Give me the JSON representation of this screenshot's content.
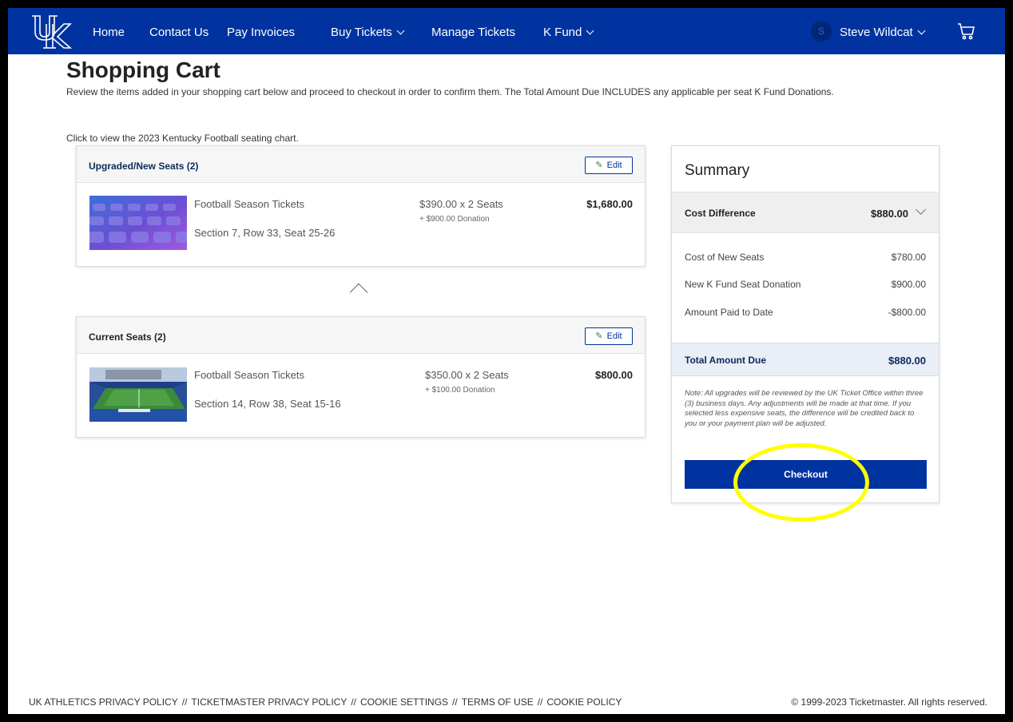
{
  "nav": {
    "logo_alt": "UK",
    "items": [
      {
        "label": "Home"
      },
      {
        "label": "Contact Us"
      },
      {
        "label": "Pay Invoices"
      },
      {
        "label": "Buy Tickets"
      },
      {
        "label": "Manage Tickets"
      },
      {
        "label": "K Fund"
      }
    ],
    "avatar_initial": "S",
    "user_name": "Steve Wildcat",
    "brand_color": "#0033a0"
  },
  "page": {
    "title": "Shopping Cart",
    "intro": "Review the items added in your shopping cart below and proceed to checkout in order to confirm them. The Total Amount Due INCLUDES any applicable per seat K Fund Donations.",
    "chart_link": "Click to view the 2023 Kentucky Football seating chart."
  },
  "upgraded": {
    "title": "Upgraded/New Seats (2)",
    "edit_label": "Edit",
    "item": {
      "name": "Football Season Tickets",
      "seats": "Section 7, Row 33, Seat 25-26",
      "price": "$390.00 x 2 Seats",
      "donation": "+ $900.00 Donation",
      "total": "$1,680.00"
    }
  },
  "current": {
    "title": "Current Seats (2)",
    "edit_label": "Edit",
    "item": {
      "name": "Football Season Tickets",
      "seats": "Section 14, Row 38, Seat 15-16",
      "price": "$350.00 x 2 Seats",
      "donation": "+ $100.00 Donation",
      "total": "$800.00"
    }
  },
  "summary": {
    "title": "Summary",
    "cost_difference_label": "Cost Difference",
    "cost_difference_value": "$880.00",
    "lines": [
      {
        "label": "Cost of New Seats",
        "value": "$780.00"
      },
      {
        "label": "New K Fund Seat Donation",
        "value": "$900.00"
      },
      {
        "label": "Amount Paid to Date",
        "value": "-$800.00"
      }
    ],
    "total_label": "Total Amount Due",
    "total_value": "$880.00",
    "note": "Note: All upgrades will be reviewed by the UK Ticket Office within three (3) business days. Any adjustments will be made at that time. If you selected less expensive seats, the difference will be credited back to you or your payment plan will be adjusted.",
    "checkout_label": "Checkout",
    "highlight_color": "#ffff00"
  },
  "footer": {
    "links": [
      "UK ATHLETICS PRIVACY POLICY",
      "TICKETMASTER PRIVACY POLICY",
      "COOKIE SETTINGS",
      "TERMS OF USE",
      "COOKIE POLICY"
    ],
    "separator": "//",
    "copyright": "© 1999-2023 Ticketmaster. All rights reserved."
  }
}
